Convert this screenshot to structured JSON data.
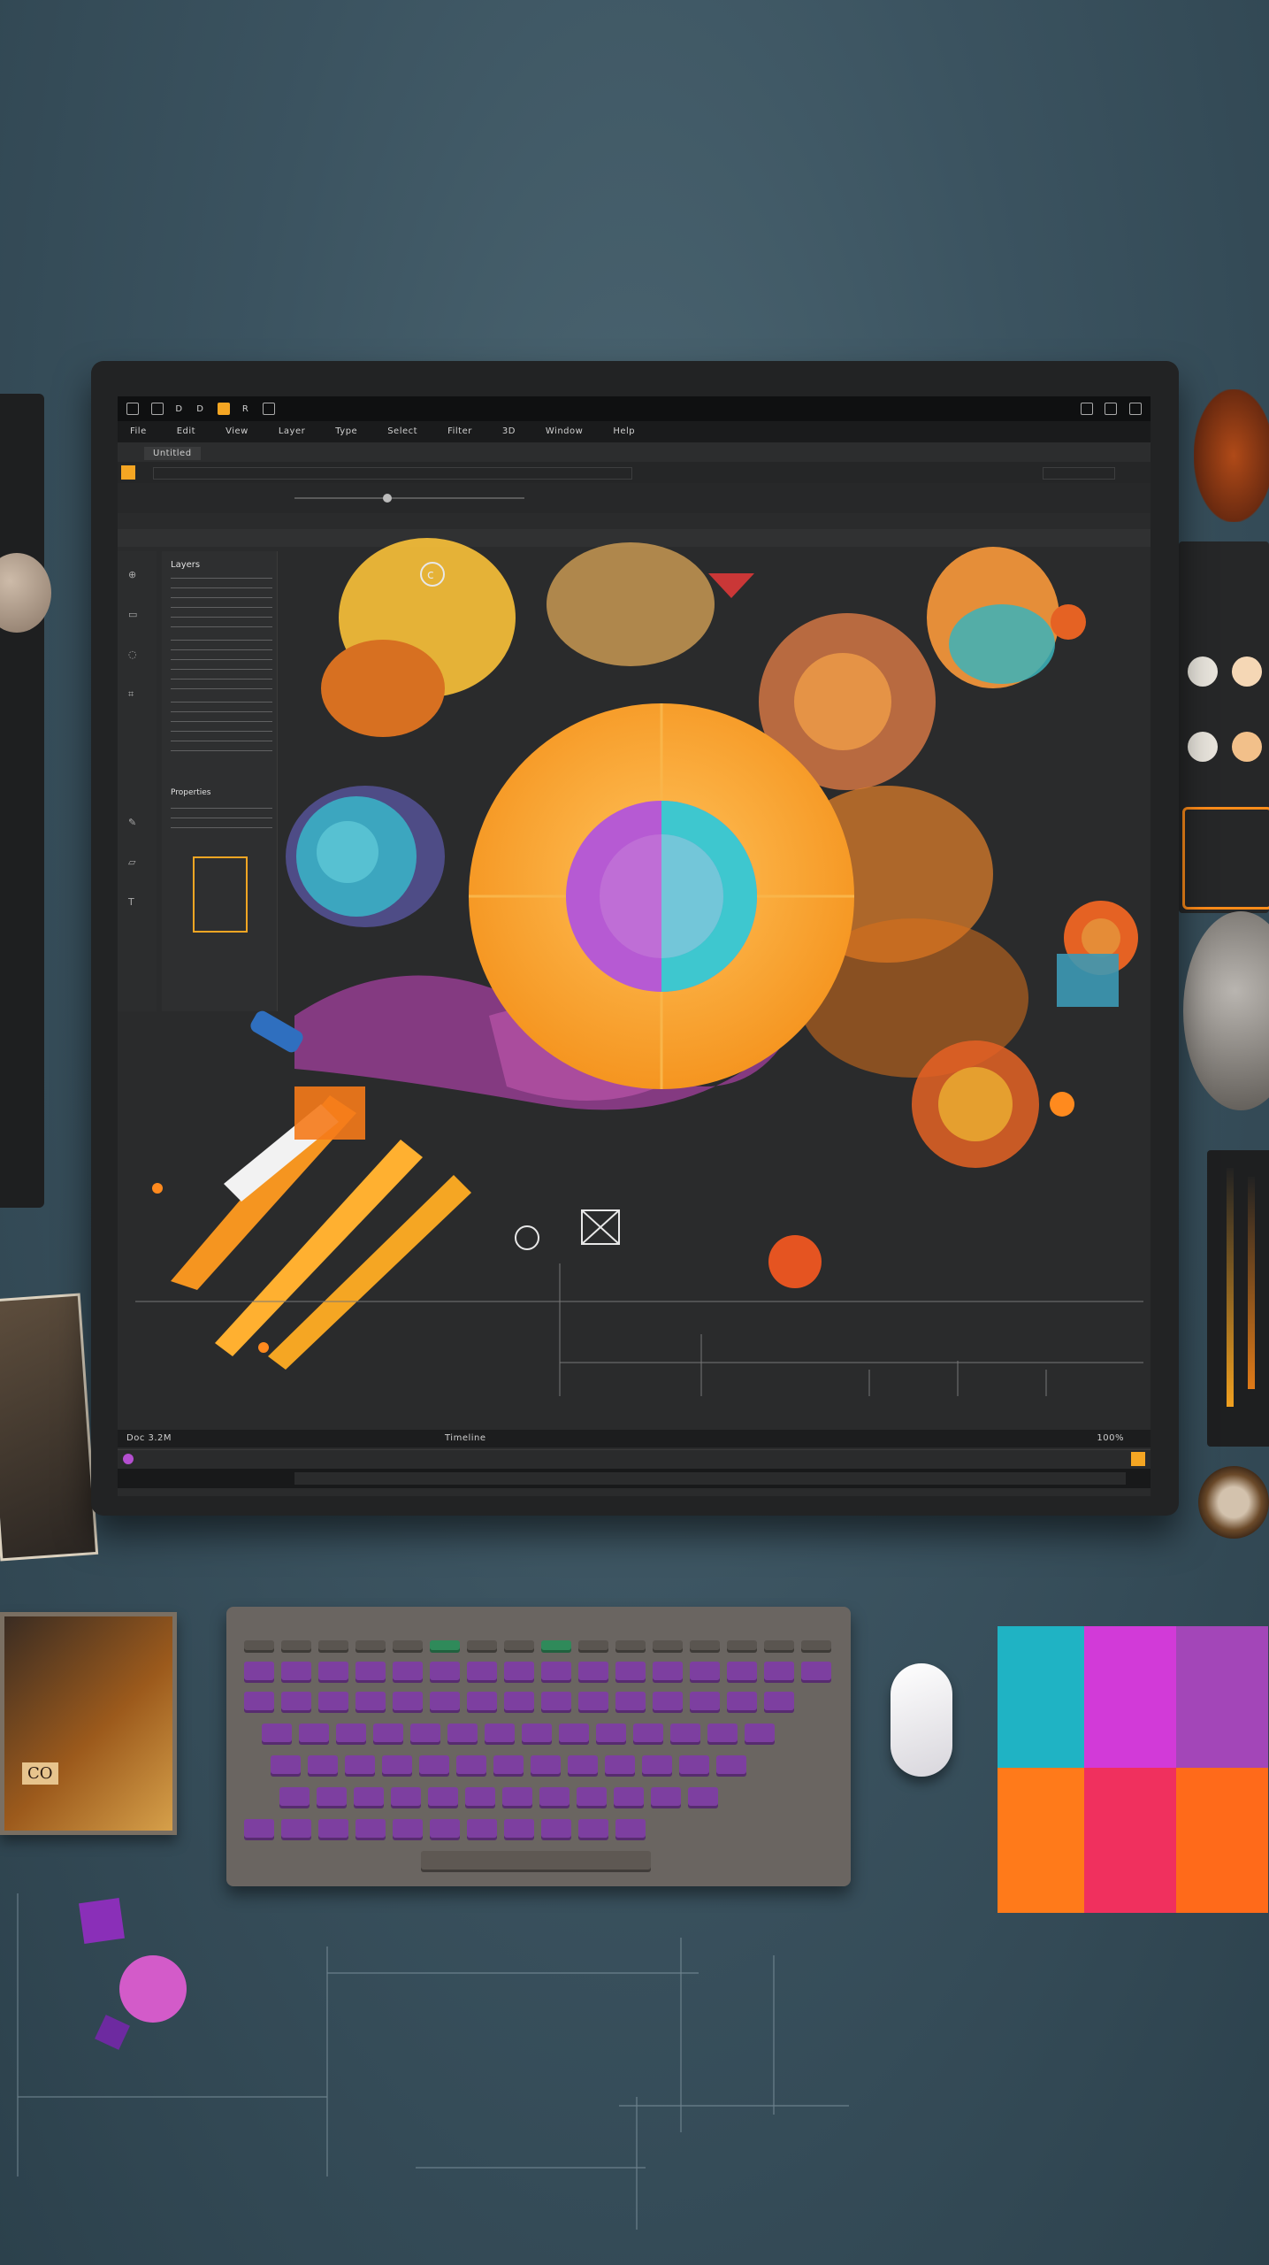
{
  "colors": {
    "desk": "#3b5360",
    "bezel": "#222324",
    "screen": "#2a2b2c",
    "accent_orange": "#f5a623",
    "accent_teal": "#3ec7cf",
    "accent_violet": "#b44fd0",
    "accent_pink": "#e53c91"
  },
  "app": {
    "top_icons": [
      "D",
      "D",
      "R"
    ],
    "menu": [
      "File",
      "Edit",
      "View",
      "Layer",
      "Type",
      "Select",
      "Filter",
      "3D",
      "Window",
      "Help"
    ],
    "tab_label": "Untitled",
    "statusbar": {
      "left": "Doc 3.2M",
      "center": "Timeline",
      "right": "100%"
    }
  },
  "side_panel": {
    "heading": "Layers",
    "note": "Properties"
  },
  "canvas": {
    "glyph_label": "c",
    "marker_label": "X"
  },
  "desk_items": {
    "photo_caption": "CO",
    "keyboard_brand": "",
    "mouse_brand": ""
  }
}
